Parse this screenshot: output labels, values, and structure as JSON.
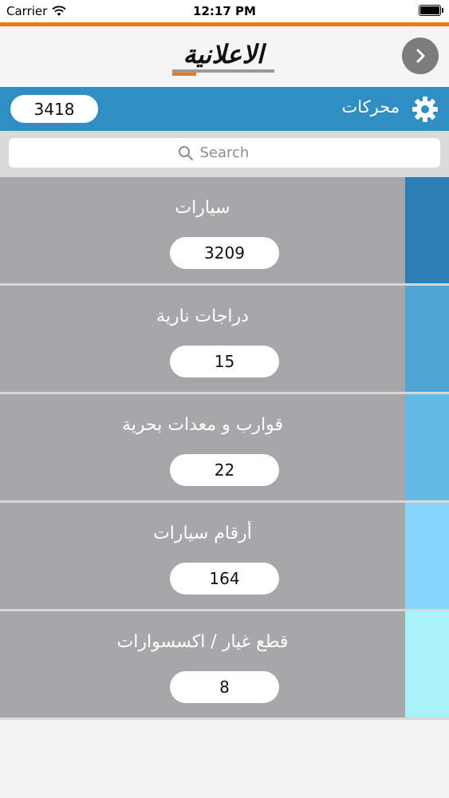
{
  "status_bar": {
    "carrier": "Carrier",
    "time": "12:17 PM"
  },
  "header": {
    "logo_text": "الاعلانية"
  },
  "category_bar": {
    "title": "محركات",
    "total_count": "3418"
  },
  "search": {
    "placeholder": "Search"
  },
  "items": [
    {
      "label": "سيارات",
      "count": "3209",
      "color": "#2b7fb2"
    },
    {
      "label": "دراجات نارية",
      "count": "15",
      "color": "#4ea4d4"
    },
    {
      "label": "قوارب و معدات بحرية",
      "count": "22",
      "color": "#62b8e6"
    },
    {
      "label": "أرقام سيارات",
      "count": "164",
      "color": "#86d6fb"
    },
    {
      "label": "قطع غيار / اكسسوارات",
      "count": "8",
      "color": "#a8f2fb"
    }
  ],
  "colors": {
    "accent_orange": "#f07a1a",
    "category_blue": "#2f8fc4",
    "item_gray": "#a7a7aa"
  },
  "icons": [
    "wifi-icon",
    "battery-icon",
    "forward-arrow-icon",
    "gear-icon",
    "search-icon"
  ]
}
